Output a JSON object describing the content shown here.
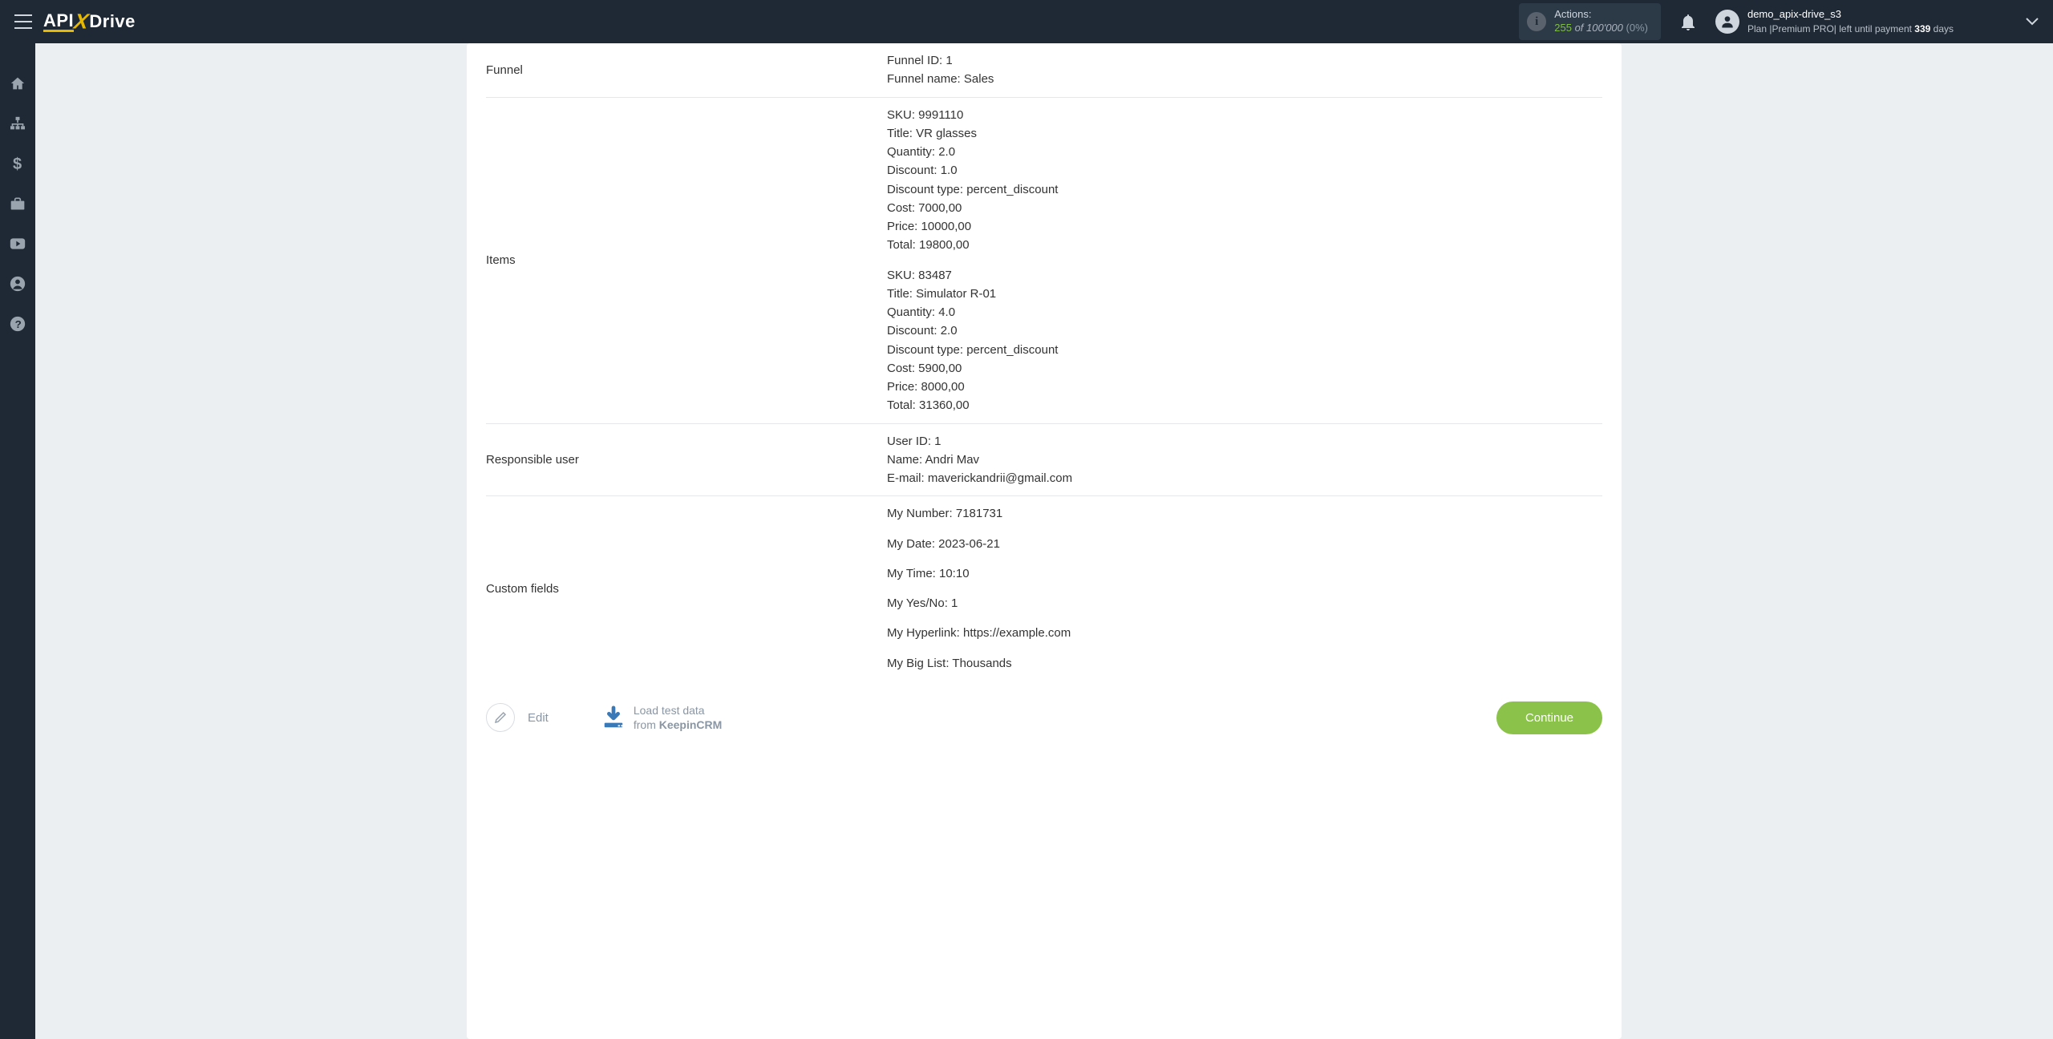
{
  "brand": {
    "p1": "API",
    "p2": "Drive"
  },
  "header": {
    "actions_label": "Actions:",
    "actions_count": "255",
    "actions_of": " of ",
    "actions_limit": "100'000",
    "actions_pct": " (0%)",
    "username": "demo_apix-drive_s3",
    "plan_line_pre": "Plan  |",
    "plan_name": "Premium PRO",
    "plan_line_post": "|  left until payment ",
    "plan_days": "339",
    "plan_days_suffix": " days"
  },
  "rows": {
    "funnel_label": "Funnel",
    "funnel": [
      "Funnel ID: 1",
      "Funnel name: Sales"
    ],
    "items_label": "Items",
    "items": [
      [
        "SKU: 9991110",
        "Title: VR glasses",
        "Quantity: 2.0",
        "Discount: 1.0",
        "Discount type: percent_discount",
        "Cost: 7000,00",
        "Price: 10000,00",
        "Total: 19800,00"
      ],
      [
        "SKU: 83487",
        "Title: Simulator R-01",
        "Quantity: 4.0",
        "Discount: 2.0",
        "Discount type: percent_discount",
        "Cost: 5900,00",
        "Price: 8000,00",
        "Total: 31360,00"
      ]
    ],
    "resp_label": "Responsible user",
    "resp": [
      "User ID: 1",
      "Name: Andri Mav",
      "E-mail: maverickandrii@gmail.com"
    ],
    "custom_label": "Custom fields",
    "custom": [
      "My Number: 7181731",
      "My Date: 2023-06-21",
      "My Time: 10:10",
      "My Yes/No: 1",
      "My Hyperlink: https://example.com",
      "My Big List: Thousands"
    ]
  },
  "footer": {
    "edit": "Edit",
    "load_line1": "Load test data",
    "load_line2_pre": "from ",
    "load_line2_bold": "KeepinCRM",
    "continue": "Continue"
  }
}
